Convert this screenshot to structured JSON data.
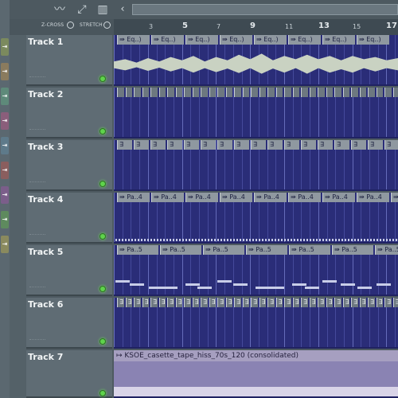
{
  "toolbar": {
    "icons": [
      "waveform-icon",
      "snap-icon",
      "piano-keys-icon"
    ],
    "zcross_label": "Z-CROSS",
    "stretch_label": "STRETCH"
  },
  "ruler": {
    "bars": [
      "3",
      "5",
      "7",
      "9",
      "11",
      "13",
      "15",
      "17"
    ]
  },
  "tracks": [
    {
      "name": "Track 1",
      "clip_label": "Eq..)"
    },
    {
      "name": "Track 2",
      "clip_label": ""
    },
    {
      "name": "Track 3",
      "clip_label": ""
    },
    {
      "name": "Track 4",
      "clip_label": "Pa..4"
    },
    {
      "name": "Track 5",
      "clip_label": "Pa..5"
    },
    {
      "name": "Track 6",
      "clip_label": ""
    },
    {
      "name": "Track 7",
      "clip_label": "KSOE_casette_tape_hiss_70s_120 (consolidated)"
    }
  ],
  "colors": {
    "lane_bg": "#2a2d78",
    "led_green": "#5fd34c",
    "strip_colors": [
      "#7b8a5e",
      "#8a7b5e",
      "#5e8a7a",
      "#8a5e7b",
      "#5e7a8a",
      "#8a5e5e",
      "#7b5e8a",
      "#5e8a5e",
      "#8a8a5e"
    ]
  }
}
